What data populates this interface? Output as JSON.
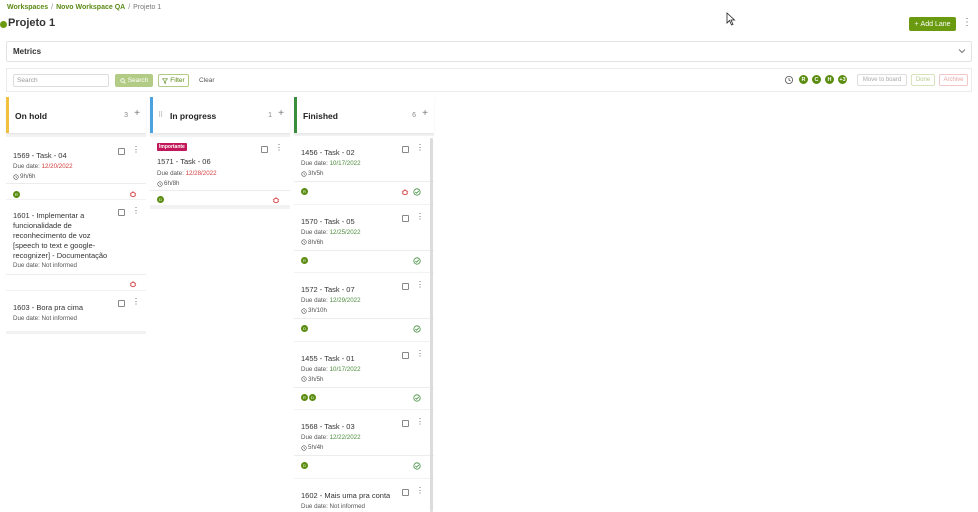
{
  "breadcrumb": {
    "items": [
      "Workspaces",
      "Novo Workspace QA",
      "Projeto 1"
    ],
    "sep": "/"
  },
  "page": {
    "title": "Projeto 1"
  },
  "header": {
    "add_lane_label": "Add Lane",
    "kebab": "⋮"
  },
  "metrics": {
    "title": "Metrics"
  },
  "toolbar": {
    "search_placeholder": "Search",
    "search_label": "Search",
    "filter_label": "Filter",
    "clear_label": "Clear",
    "avatars": [
      "R",
      "C",
      "H",
      "+3"
    ],
    "move_label": "Move to board",
    "done_label": "Done",
    "archive_label": "Archive"
  },
  "colors": {
    "accent": "#6a9a10",
    "on_hold": "#f0c040",
    "in_progress": "#4aa3df",
    "finished": "#3b8c3b",
    "due_red": "#d23b3b",
    "due_green": "#4b8c3b",
    "important": "#c2185b"
  },
  "lanes": [
    {
      "title": "On hold",
      "count": "3",
      "add": "+",
      "cards": [
        {
          "title": "1569 - Task - 04",
          "due_prefix": "Due date: ",
          "due": "12/20/2022",
          "time": "9h/6h"
        },
        {
          "title_lines": [
            "1601 - Implementar a",
            "funcionalidade de",
            "reconhecimento de voz",
            "[speech to text e google-",
            "recognizer] - Documentação"
          ],
          "due_text": "Due date: Not informed"
        },
        {
          "title": "1603 - Bora pra cima",
          "due_text": "Due date: Not informed"
        }
      ]
    },
    {
      "title": "In progress",
      "count": "1",
      "add": "+",
      "cards": [
        {
          "badge": "Importante",
          "title": "1571 - Task - 06",
          "due_prefix": "Due date: ",
          "due": "12/28/2022",
          "time": "6h/8h"
        }
      ]
    },
    {
      "title": "Finished",
      "count": "6",
      "add": "+",
      "cards": [
        {
          "title": "1456 - Task - 02",
          "due_prefix": "Due date: ",
          "due": "10/17/2022",
          "time": "3h/5h"
        },
        {
          "title": "1570 - Task - 05",
          "due_prefix": "Due date: ",
          "due": "12/25/2022",
          "time": "8h/6h"
        },
        {
          "title": "1572 - Task - 07",
          "due_prefix": "Due date: ",
          "due": "12/29/2022",
          "time": "3h/10h"
        },
        {
          "title": "1455 - Task - 01",
          "due_prefix": "Due date: ",
          "due": "10/17/2022",
          "time": "3h/5h"
        },
        {
          "title": "1568 - Task - 03",
          "due_prefix": "Due date: ",
          "due": "12/22/2022",
          "time": "5h/4h"
        },
        {
          "title": "1602 - Mais uma pra conta",
          "due_text": "Due date: Not informed"
        }
      ]
    }
  ]
}
